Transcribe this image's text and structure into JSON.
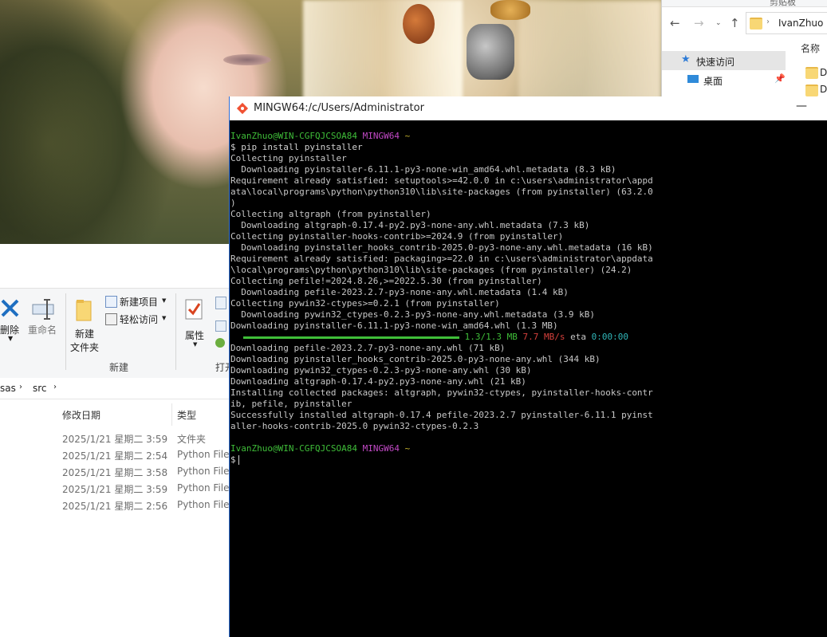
{
  "explorer_left": {
    "ribbon": {
      "delete_label": "删除",
      "rename_label": "重命名",
      "new_item_label": "新建项目",
      "easy_access_label": "轻松访问",
      "new_folder_label_1": "新建",
      "new_folder_label_2": "文件夹",
      "group_new_label": "新建",
      "properties_label": "属性",
      "open_label": "打开"
    },
    "breadcrumb": [
      "sas",
      "src"
    ],
    "columns": {
      "modified": "修改日期",
      "type": "类型"
    },
    "files": [
      {
        "modified": "2025/1/21 星期二 3:59",
        "type": "文件夹"
      },
      {
        "modified": "2025/1/21 星期二 2:54",
        "type": "Python File"
      },
      {
        "modified": "2025/1/21 星期二 3:58",
        "type": "Python File"
      },
      {
        "modified": "2025/1/21 星期二 3:59",
        "type": "Python File"
      },
      {
        "modified": "2025/1/21 星期二 2:56",
        "type": "Python File"
      }
    ]
  },
  "explorer_right": {
    "path": "IvanZhuo",
    "col_name": "名称",
    "quick_access": "快速访问",
    "desktop": "桌面",
    "item_partial_1": "Dl",
    "item_partial_2": "Do",
    "top_partial": "剪贴板"
  },
  "terminal": {
    "title": "MINGW64:/c/Users/Administrator",
    "prompt_user": "IvanZhuo@WIN-CGFQJCSOA84",
    "prompt_env": "MINGW64",
    "prompt_dir": "~",
    "command": "$ pip install pyinstaller",
    "lines": [
      "Collecting pyinstaller",
      "  Downloading pyinstaller-6.11.1-py3-none-win_amd64.whl.metadata (8.3 kB)",
      "Requirement already satisfied: setuptools>=42.0.0 in c:\\users\\administrator\\appd",
      "ata\\local\\programs\\python\\python310\\lib\\site-packages (from pyinstaller) (63.2.0",
      ")",
      "Collecting altgraph (from pyinstaller)",
      "  Downloading altgraph-0.17.4-py2.py3-none-any.whl.metadata (7.3 kB)",
      "Collecting pyinstaller-hooks-contrib>=2024.9 (from pyinstaller)",
      "  Downloading pyinstaller_hooks_contrib-2025.0-py3-none-any.whl.metadata (16 kB)",
      "Requirement already satisfied: packaging>=22.0 in c:\\users\\administrator\\appdata",
      "\\local\\programs\\python\\python310\\lib\\site-packages (from pyinstaller) (24.2)",
      "Collecting pefile!=2024.8.26,>=2022.5.30 (from pyinstaller)",
      "  Downloading pefile-2023.2.7-py3-none-any.whl.metadata (1.4 kB)",
      "Collecting pywin32-ctypes>=0.2.1 (from pyinstaller)",
      "  Downloading pywin32_ctypes-0.2.3-py3-none-any.whl.metadata (3.9 kB)",
      "Downloading pyinstaller-6.11.1-py3-none-win_amd64.whl (1.3 MB)"
    ],
    "progress": {
      "fraction": 1.0,
      "size": "1.3/1.3 MB",
      "speed": "7.7 MB/s",
      "eta_label": "eta",
      "eta": "0:00:00"
    },
    "lines2": [
      "Downloading pefile-2023.2.7-py3-none-any.whl (71 kB)",
      "Downloading pyinstaller_hooks_contrib-2025.0-py3-none-any.whl (344 kB)",
      "Downloading pywin32_ctypes-0.2.3-py3-none-any.whl (30 kB)",
      "Downloading altgraph-0.17.4-py2.py3-none-any.whl (21 kB)",
      "Installing collected packages: altgraph, pywin32-ctypes, pyinstaller-hooks-contr",
      "ib, pefile, pyinstaller",
      "Successfully installed altgraph-0.17.4 pefile-2023.2.7 pyinstaller-6.11.1 pyinst",
      "aller-hooks-contrib-2025.0 pywin32-ctypes-0.2.3"
    ],
    "final_prompt": "$"
  },
  "colors": {
    "term_green": "#3fbe39",
    "term_magenta": "#c249c6",
    "term_yellow": "#c6b42e",
    "term_red": "#d6403c",
    "term_cyan": "#30b6b8"
  }
}
